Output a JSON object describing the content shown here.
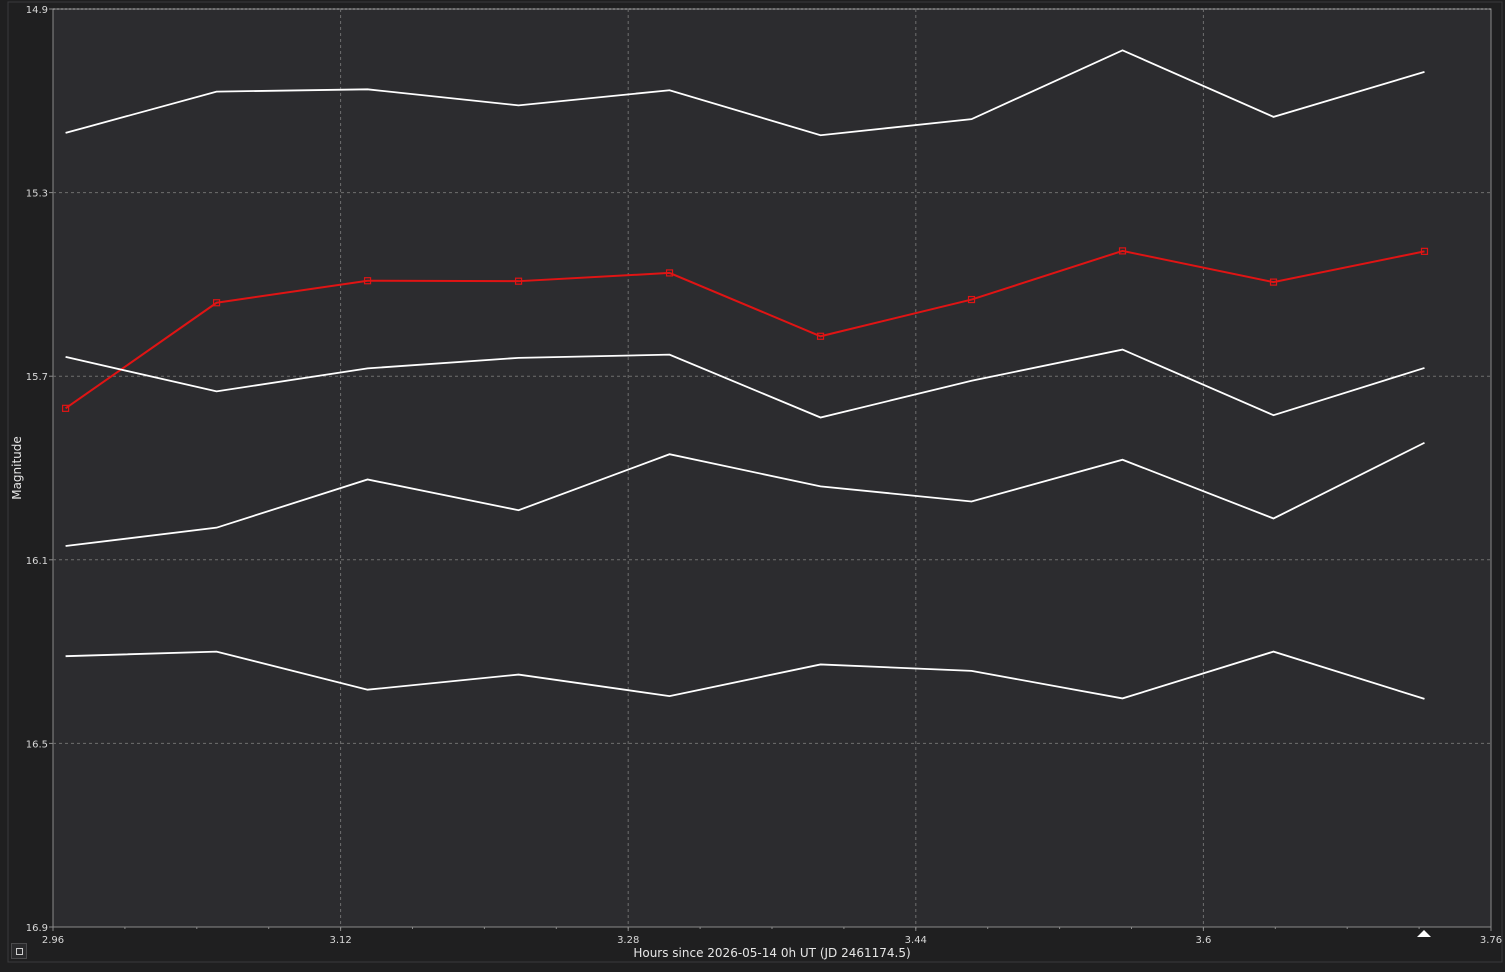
{
  "colors": {
    "background": "#1f1f20",
    "plot_background": "#2c2c2f",
    "grid": "#6e6e6e",
    "frame": "#8a8a8a",
    "comparison_series": "#ffffff",
    "target_series": "#e01414",
    "text": "#d8d8d8"
  },
  "icons": {
    "corner_button": "square-icon",
    "scroll_marker": "triangle-up-icon"
  },
  "chart_data": {
    "type": "line",
    "title": "",
    "xlabel": "Hours since 2026-05-14 0h UT (JD 2461174.5)",
    "ylabel": "Magnitude",
    "xlim": [
      2.96,
      3.76
    ],
    "ylim": [
      14.9,
      16.9
    ],
    "y_inverted": true,
    "grid": true,
    "legend": "none",
    "xticks": [
      "2.96",
      "3.12",
      "3.28",
      "3.44",
      "3.6",
      "3.76"
    ],
    "yticks": [
      "14.9",
      "15.3",
      "15.7",
      "16.1",
      "16.5",
      "16.9"
    ],
    "x": [
      2.967,
      3.051,
      3.135,
      3.219,
      3.303,
      3.387,
      3.471,
      3.555,
      3.639,
      3.723
    ],
    "series": [
      {
        "color": "#ffffff",
        "markers": false,
        "values": [
          15.17,
          15.08,
          15.075,
          15.11,
          15.077,
          15.175,
          15.14,
          14.99,
          15.135,
          15.037
        ]
      },
      {
        "color": "#e01414",
        "markers": true,
        "values": [
          15.77,
          15.54,
          15.492,
          15.493,
          15.475,
          15.613,
          15.533,
          15.427,
          15.495,
          15.428
        ]
      },
      {
        "color": "#ffffff",
        "markers": false,
        "values": [
          15.658,
          15.733,
          15.683,
          15.66,
          15.653,
          15.79,
          15.71,
          15.642,
          15.785,
          15.682
        ]
      },
      {
        "color": "#ffffff",
        "markers": false,
        "values": [
          16.07,
          16.03,
          15.925,
          15.992,
          15.87,
          15.94,
          15.973,
          15.882,
          16.01,
          15.845
        ]
      },
      {
        "color": "#ffffff",
        "markers": false,
        "values": [
          16.31,
          16.3,
          16.383,
          16.35,
          16.397,
          16.328,
          16.342,
          16.402,
          16.3,
          16.403
        ]
      }
    ]
  }
}
